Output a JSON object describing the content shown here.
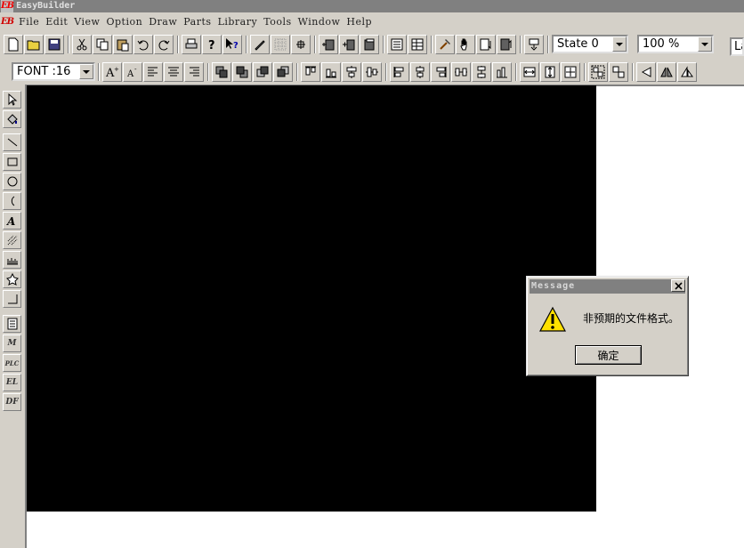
{
  "app": {
    "logo": "EB",
    "title": "EasyBuilder"
  },
  "menu": [
    "File",
    "Edit",
    "View",
    "Option",
    "Draw",
    "Parts",
    "Library",
    "Tools",
    "Window",
    "Help"
  ],
  "toolbar1": {
    "state_value": "State  0",
    "zoom_value": "100 %",
    "layer_value": "La"
  },
  "toolbar2": {
    "font_value": "FONT :16"
  },
  "leftbar": {
    "m_label": "M",
    "plc_label": "PLC",
    "el_label": "EL",
    "df_label": "DF"
  },
  "dialog": {
    "title": "Message",
    "message": "非预期的文件格式。",
    "ok_label": "确定"
  },
  "colors": {
    "face": "#d4d0c8",
    "titlebar": "#808080",
    "screen": "#000000",
    "logo": "#d00000"
  }
}
